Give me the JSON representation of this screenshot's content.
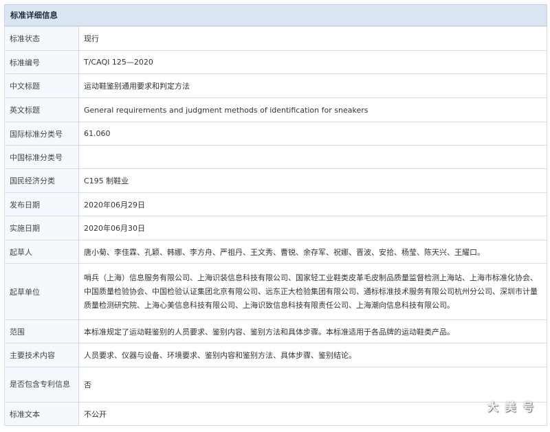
{
  "header": {
    "title": "标准详细信息"
  },
  "rows": [
    {
      "label": "标准状态",
      "value": "现行"
    },
    {
      "label": "标准编号",
      "value": "T/CAQI 125—2020"
    },
    {
      "label": "中文标题",
      "value": "运动鞋鉴别通用要求和判定方法"
    },
    {
      "label": "英文标题",
      "value": "General requirements and judgment methods of identification for sneakers"
    },
    {
      "label": "国际标准分类号",
      "value": "61.060"
    },
    {
      "label": "中国标准分类号",
      "value": ""
    },
    {
      "label": "国民经济分类",
      "value": "C195 制鞋业"
    },
    {
      "label": "发布日期",
      "value": "2020年06月29日"
    },
    {
      "label": "实施日期",
      "value": "2020年06月30日"
    },
    {
      "label": "起草人",
      "value": "唐小菊、李佳霖、孔颖、韩娜、李方舟、严祖丹、王文秀、曹锐、余存军、祝娜、晋波、安拾、杨莹、陈天兴、王耀口。"
    },
    {
      "label": "起草单位",
      "value": "哨兵（上海）信息服务有限公司、上海识装信息科技有限公司、国家轻工业鞋类皮革毛皮制品质量监督检测上海站、上海市标准化协会、中国质量检验协会、中国检验认证集团北京有限公司、远东正大检验集团有限公司、通标标准技术服务有限公司杭州分公司、深圳市计量质量检测研究院、上海心美信息科技有限公司、上海识致信息科技有限责任公司、上海潮向信息科技有限公司。"
    },
    {
      "label": "范围",
      "value": "本标准规定了运动鞋鉴别的人员要求、鉴别内容、鉴别方法和具体步骤。本标准适用于各品牌的运动鞋类产品。"
    },
    {
      "label": "主要技术内容",
      "value": "人员要求、仪器与设备、环境要求、鉴别内容和鉴别方法、具体步骤、鉴别结论。"
    },
    {
      "label": "是否包含专利信息",
      "value": "否"
    },
    {
      "label": "标准文本",
      "value": "不公开"
    }
  ],
  "watermark": {
    "text": "大 美 号"
  }
}
